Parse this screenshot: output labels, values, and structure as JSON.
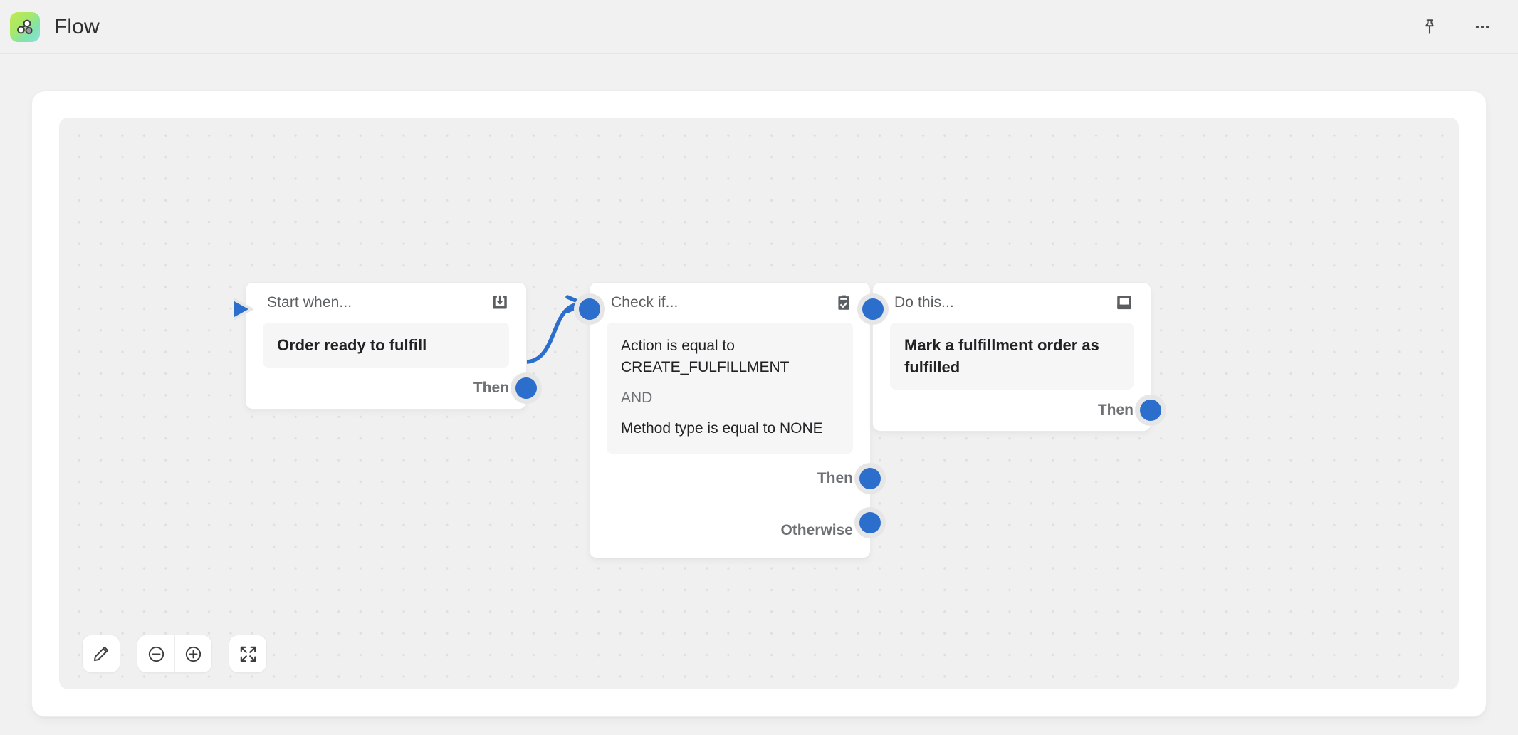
{
  "header": {
    "title": "Flow",
    "logo_icon": "flow-graph-logo-icon",
    "logo_gradient_from": "#C2E84F",
    "logo_gradient_to": "#8FE0DC",
    "actions": [
      {
        "name": "pin-icon",
        "label": "Pin"
      },
      {
        "name": "more-options-icon",
        "label": "More options"
      }
    ]
  },
  "theme": {
    "accent_blue": "#2C6ECB",
    "connector_blue": "#2C6ECB",
    "page_bg": "#F1F1F1",
    "canvas_bg": "#F0F0F0",
    "canvas_dot": "#DFDFDF",
    "card_bg": "#FFFFFF",
    "chip_bg": "#F6F6F7",
    "label_gray": "#6D7175",
    "text_dark": "#202223",
    "port_halo": "#E6E6E6"
  },
  "canvas": {
    "nodes": [
      {
        "id": "trigger",
        "head_label": "Start when...",
        "head_icon": "inbox-download-icon",
        "chip_text": "Order ready to fulfill",
        "has_start_marker": true,
        "ports": [
          {
            "label": "Then",
            "name": "port-then"
          }
        ]
      },
      {
        "id": "condition",
        "head_label": "Check if...",
        "head_icon": "clipboard-check-icon",
        "conditions": [
          {
            "type": "condition",
            "text": "Action is equal to CREATE_FULFILLMENT"
          },
          {
            "type": "operator",
            "text": "AND"
          },
          {
            "type": "condition",
            "text": "Method type is equal to NONE"
          }
        ],
        "ports": [
          {
            "label": "Then",
            "name": "port-then"
          },
          {
            "label": "Otherwise",
            "name": "port-otherwise"
          }
        ]
      },
      {
        "id": "action",
        "head_label": "Do this...",
        "head_icon": "inbox-tray-icon",
        "chip_text": "Mark a fulfillment order as fulfilled",
        "ports": [
          {
            "label": "Then",
            "name": "port-then"
          }
        ]
      }
    ],
    "connections": [
      {
        "from": "trigger.then",
        "to": "condition.input"
      },
      {
        "from": "condition.then",
        "to": "action.input"
      }
    ],
    "toolbar": {
      "edit": {
        "name": "edit-pencil-icon",
        "label": "Edit"
      },
      "zoom_out": {
        "name": "zoom-out-icon",
        "label": "Zoom out"
      },
      "zoom_in": {
        "name": "zoom-in-icon",
        "label": "Zoom in"
      },
      "collapse": {
        "name": "collapse-fit-icon",
        "label": "Collapse"
      }
    }
  }
}
